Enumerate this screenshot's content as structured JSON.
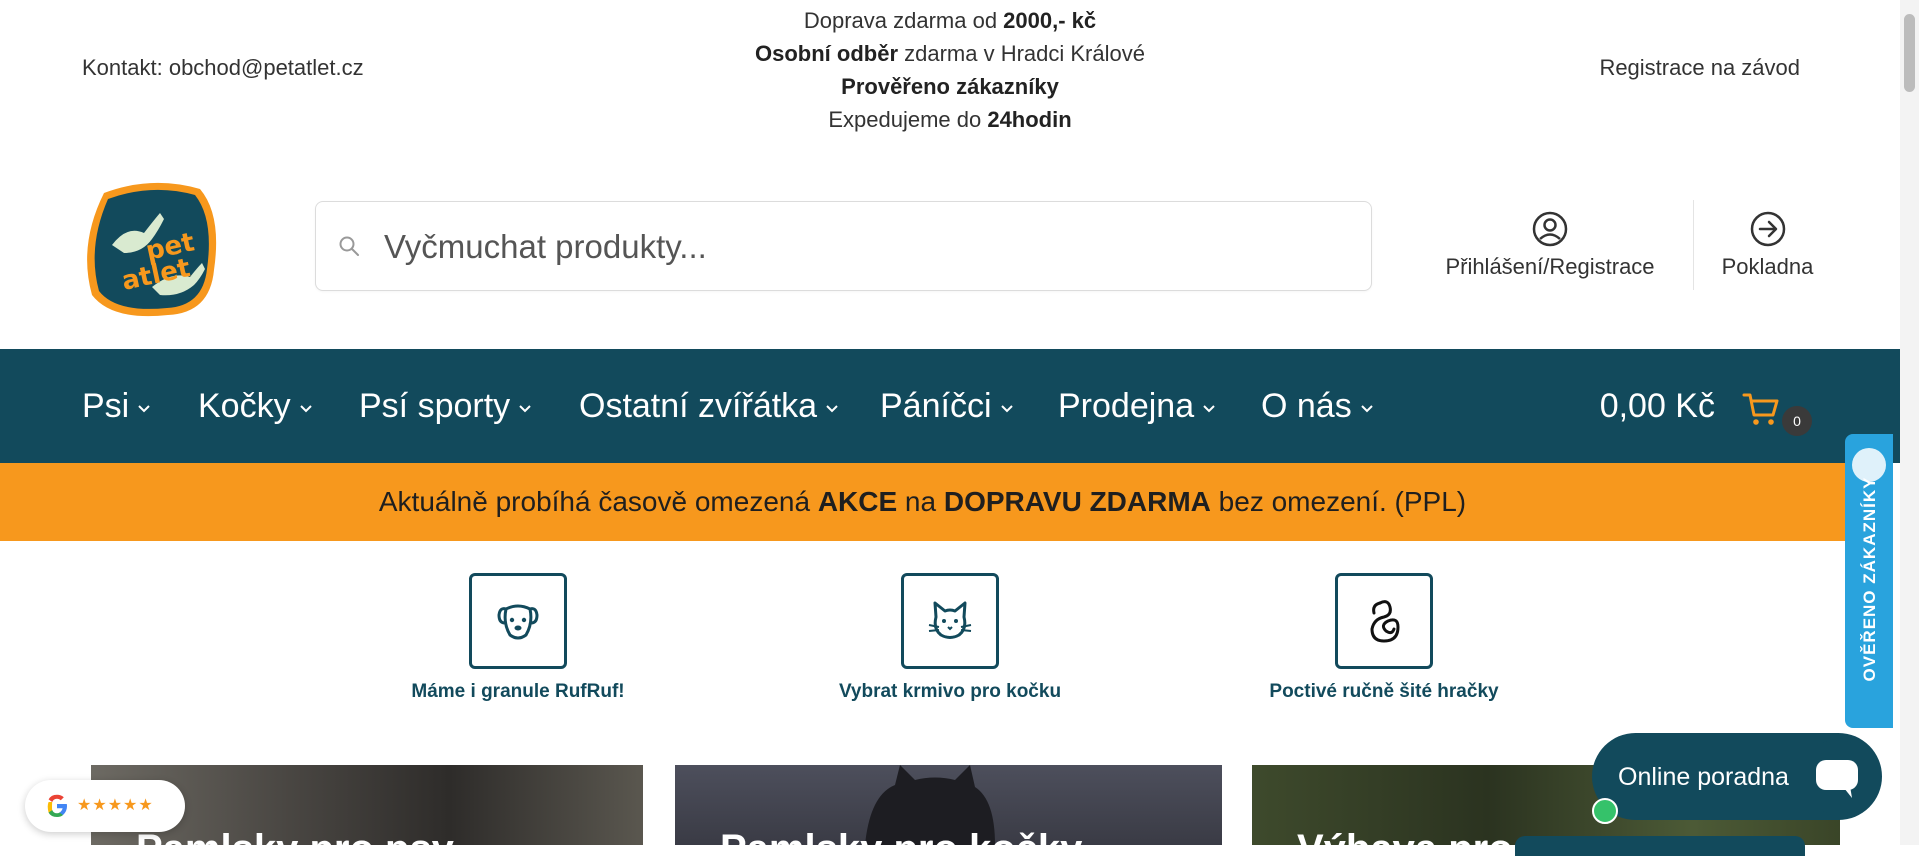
{
  "topbar": {
    "contact": "Kontakt: obchod@petatlet.cz",
    "usp": [
      {
        "pre": "Doprava zdarma od ",
        "bold": "2000,- kč",
        "post": ""
      },
      {
        "pre": "",
        "bold": "Osobní odběr",
        "post": " zdarma v Hradci Králové"
      },
      {
        "pre": "",
        "bold": "Prověřeno zákazníky",
        "post": ""
      },
      {
        "pre": "Expedujeme do ",
        "bold": "24hodin",
        "post": ""
      }
    ],
    "factory_link": "Registrace na závod"
  },
  "logo": {
    "alt": "pet atlet",
    "word1": "pet",
    "word2": "atlet"
  },
  "search": {
    "placeholder": "Vyčmuchat produkty..."
  },
  "header_actions": {
    "login_label": "Přihlášení/Registrace",
    "checkout_label": "Pokladna"
  },
  "nav": {
    "items": [
      "Psi",
      "Kočky",
      "Psí sporty",
      "Ostatní zvířátka",
      "Páníčci",
      "Prodejna",
      "O nás"
    ],
    "cart_total": "0,00 Kč",
    "cart_count": "0"
  },
  "promo": {
    "pre": "Aktuálně probíhá časově omezená ",
    "bold1": "AKCE",
    "mid": " na ",
    "bold2": "DOPRAVU ZDARMA",
    "post": " bez omezení. (PPL)"
  },
  "shortcuts": [
    {
      "label": "Máme i granule RufRuf!",
      "icon": "dog-face-icon"
    },
    {
      "label": "Vybrat krmivo pro kočku",
      "icon": "cat-face-icon"
    },
    {
      "label": "Poctivé ručně šité hračky",
      "icon": "toy-knot-icon"
    }
  ],
  "cards": [
    {
      "title": "Pamlsky pro psy"
    },
    {
      "title": "Pamlsky pro kočky"
    },
    {
      "title": "Výbava pro psy"
    }
  ],
  "google_rating": {
    "stars": "★★★★★"
  },
  "chat": {
    "label": "Online poradna"
  },
  "verified_badge": {
    "label": "OVĚŘENO ZÁKAZNÍKY"
  },
  "colors": {
    "brand_teal": "#124a5c",
    "brand_orange": "#f7981d",
    "verified_blue": "#29a3dd"
  }
}
